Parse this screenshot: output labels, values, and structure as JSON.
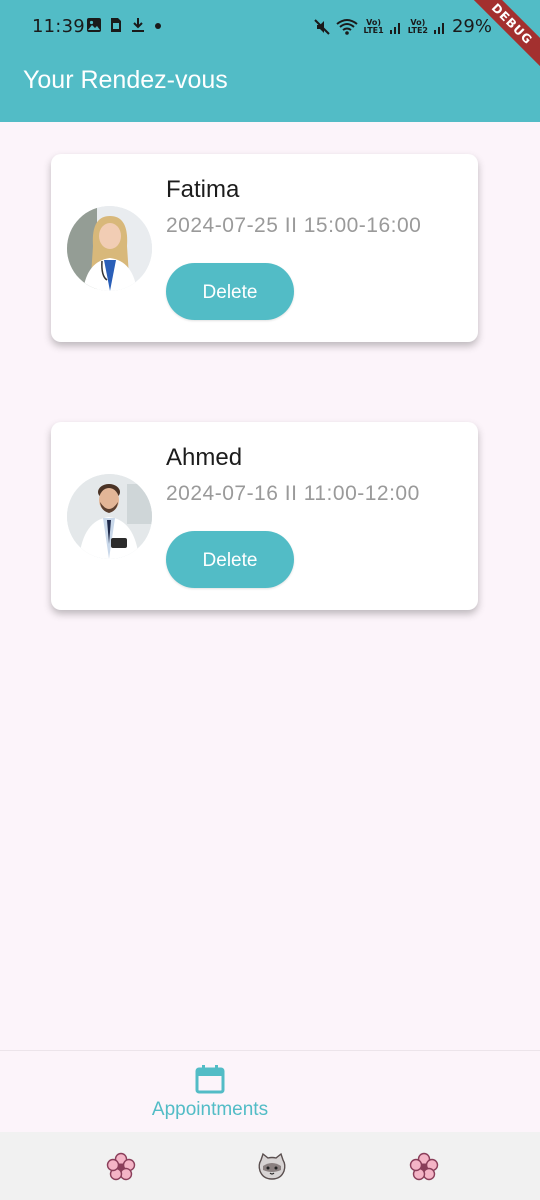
{
  "status_bar": {
    "time": "11:39",
    "battery": "29%",
    "sim1_label": "Vo) LTE1",
    "sim2_label": "Vo) LTE2"
  },
  "debug_banner": "DEBUG",
  "app_bar": {
    "title": "Your Rendez-vous"
  },
  "appointments": [
    {
      "name": "Fatima",
      "datetime": "2024-07-25 II 15:00-16:00",
      "delete_label": "Delete"
    },
    {
      "name": "Ahmed",
      "datetime": "2024-07-16 II 11:00-12:00",
      "delete_label": "Delete"
    }
  ],
  "bottom_nav": {
    "items": [
      {
        "label": "Appointments",
        "icon": "calendar-icon"
      }
    ]
  },
  "system_nav": {
    "buttons": [
      "flower-icon",
      "cat-face-icon",
      "flower-icon"
    ]
  },
  "colors": {
    "primary": "#52bcc6",
    "background": "#fcf4fa",
    "debug": "#a3302f"
  }
}
